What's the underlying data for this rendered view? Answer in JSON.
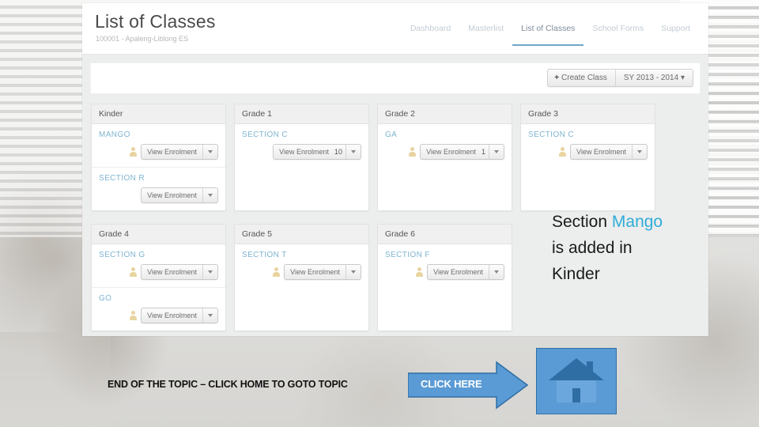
{
  "header": {
    "title": "List of Classes",
    "subtitle": "100001 - Apaleng-Liblong ES",
    "nav": [
      {
        "label": "Dashboard",
        "active": false
      },
      {
        "label": "Masterlist",
        "active": false
      },
      {
        "label": "List of Classes",
        "active": true
      },
      {
        "label": "School Forms",
        "active": false
      },
      {
        "label": "Support",
        "active": false
      }
    ]
  },
  "toolbar": {
    "plus": "+",
    "create_label": "Create Class",
    "school_year": "SY 2013 - 2014",
    "caret": "▾"
  },
  "cards": [
    {
      "grade": "Kinder",
      "sections": [
        {
          "name": "MANGO",
          "enrol_label": "View Enrolment",
          "count": "",
          "has_person_icon": true
        },
        {
          "name": "SECTION R",
          "enrol_label": "View Enrolment",
          "count": "",
          "has_person_icon": false
        }
      ]
    },
    {
      "grade": "Grade 1",
      "sections": [
        {
          "name": "SECTION C",
          "enrol_label": "View Enrolment",
          "count": "10",
          "has_person_icon": false
        }
      ]
    },
    {
      "grade": "Grade 2",
      "sections": [
        {
          "name": "GA",
          "enrol_label": "View Enrolment",
          "count": "1",
          "has_person_icon": true
        }
      ]
    },
    {
      "grade": "Grade 3",
      "sections": [
        {
          "name": "SECTION C",
          "enrol_label": "View Enrolment",
          "count": "",
          "has_person_icon": true
        }
      ]
    },
    {
      "grade": "Grade 4",
      "sections": [
        {
          "name": "SECTION G",
          "enrol_label": "View Enrolment",
          "count": "",
          "has_person_icon": true
        },
        {
          "name": "GO",
          "enrol_label": "View Enrolment",
          "count": "",
          "has_person_icon": true
        }
      ]
    },
    {
      "grade": "Grade 5",
      "sections": [
        {
          "name": "SECTION T",
          "enrol_label": "View Enrolment",
          "count": "",
          "has_person_icon": true
        }
      ]
    },
    {
      "grade": "Grade 6",
      "sections": [
        {
          "name": "SECTION F",
          "enrol_label": "View Enrolment",
          "count": "",
          "has_person_icon": true
        }
      ]
    }
  ],
  "annotation": {
    "line1_prefix": "Section ",
    "line1_highlight": "Mango",
    "line2": "is added in",
    "line3": "Kinder",
    "highlight_color": "#2fadd9"
  },
  "footer": {
    "end_text": "END OF THE TOPIC – CLICK HOME TO GOTO TOPIC",
    "arrow_label": "CLICK HERE",
    "arrow_color": "#5b9bd5",
    "home_icon": "home-icon"
  }
}
